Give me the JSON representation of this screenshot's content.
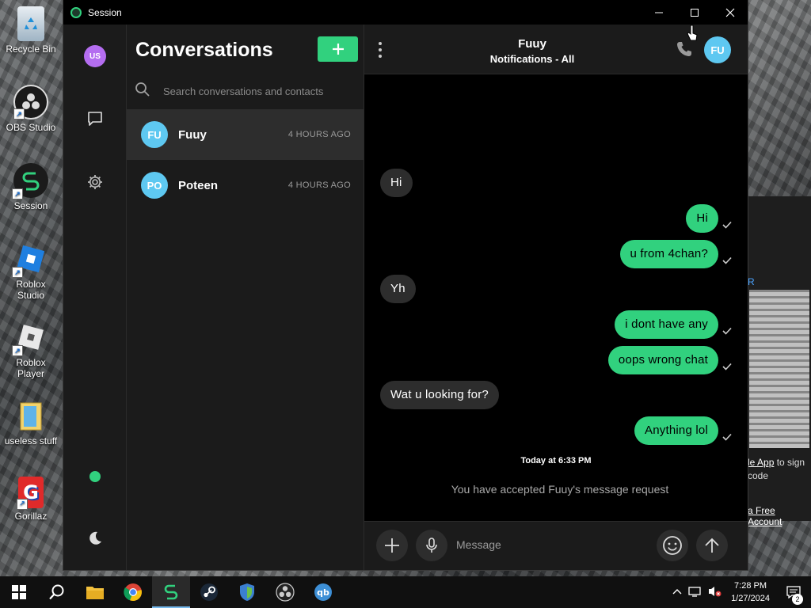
{
  "desktop": {
    "icons": [
      {
        "label": "Recycle Bin"
      },
      {
        "label": "OBS Studio"
      },
      {
        "label": "Session"
      },
      {
        "label": "Roblox Studio"
      },
      {
        "label": "Roblox Player"
      },
      {
        "label": "useless stuff"
      },
      {
        "label": "Gorillaz"
      }
    ],
    "background_window": {
      "fragment_r": "R",
      "link_app": "le App",
      "text_sign": " to sign",
      "text_code": "code",
      "link_account": "a Free Account"
    }
  },
  "window": {
    "title": "Session",
    "controls": {
      "minimize": "—",
      "maximize": "☐",
      "close": "✕"
    }
  },
  "rail": {
    "avatar_initials": "US",
    "status": "online",
    "accent": "#31d17e"
  },
  "conversations": {
    "heading": "Conversations",
    "add_label": "+",
    "search_placeholder": "Search conversations and contacts",
    "items": [
      {
        "initials": "FU",
        "name": "Fuuy",
        "time": "4 HOURS AGO",
        "active": true
      },
      {
        "initials": "PO",
        "name": "Poteen",
        "time": "4 HOURS AGO",
        "active": false
      }
    ]
  },
  "chat": {
    "title": "Fuuy",
    "subtitle": "Notifications - All",
    "avatar_initials": "FU",
    "messages": [
      {
        "direction": "in",
        "text": "Hi"
      },
      {
        "direction": "out",
        "text": "Hi",
        "status": "read"
      },
      {
        "direction": "out",
        "text": "u from 4chan?",
        "status": "read"
      },
      {
        "direction": "in",
        "text": "Yh"
      },
      {
        "direction": "out",
        "text": "i dont have any",
        "status": "read"
      },
      {
        "direction": "out",
        "text": "oops wrong chat",
        "status": "read"
      },
      {
        "direction": "in",
        "text": "Wat u looking for?"
      },
      {
        "direction": "out",
        "text": "Anything lol",
        "status": "read"
      }
    ],
    "day_label": "Today at 6:33 PM",
    "request_note": "You have accepted Fuuy's message request",
    "composer_placeholder": "Message"
  },
  "taskbar": {
    "apps": [
      "start",
      "search",
      "file-explorer",
      "chrome",
      "session",
      "steam",
      "vpn",
      "obs-studio",
      "qbittorrent"
    ],
    "time": "7:28 PM",
    "date": "1/27/2024",
    "notification_count": "2"
  }
}
